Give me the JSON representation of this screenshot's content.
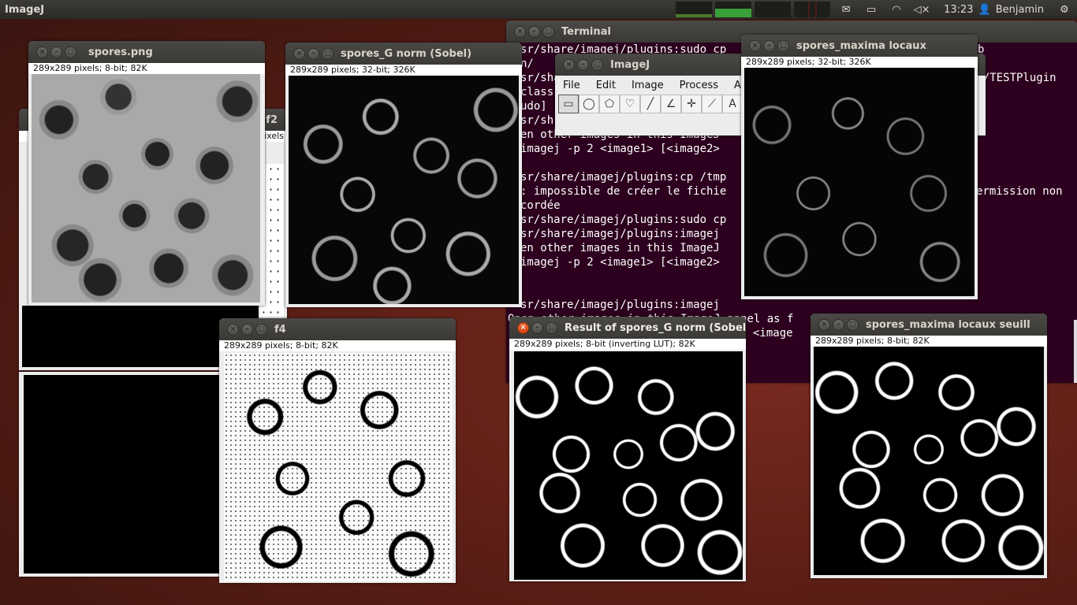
{
  "panel": {
    "app_title": "ImageJ",
    "time": "13:23",
    "user": "Benjamin",
    "icons": [
      "mail-icon",
      "battery-icon",
      "wifi-icon",
      "volume-icon",
      "gear-icon"
    ]
  },
  "windows": {
    "spores_png": {
      "title": "spores.png",
      "info": "289x289 pixels; 8-bit; 82K"
    },
    "hidden_f2": {
      "title": "f2",
      "info": "ixels"
    },
    "sobel": {
      "title": "spores_G norm (Sobel)",
      "info": "289x289 pixels; 32-bit; 326K"
    },
    "maxima": {
      "title": "spores_maxima locaux",
      "info": "289x289 pixels; 32-bit; 326K"
    },
    "f4": {
      "title": "f4",
      "info": "289x289 pixels; 8-bit; 82K"
    },
    "result": {
      "title": "Result of spores_G norm (Sobel)",
      "info": "289x289 pixels; 8-bit (inverting LUT); 82K"
    },
    "maxima_seuil": {
      "title": "spores_maxima locaux seuill",
      "info": "289x289 pixels; 8-bit; 82K"
    },
    "terminal": {
      "title": "Terminal",
      "lines": [
        "sr/share/imagej/plugins:sudo cp",
        "n/",
        "sr/share",
        "class",
        "udo]",
        "sr/sh",
        "en other images in this ImageJ",
        "imagej -p 2 <image1> [<image2>",
        "",
        "sr/share/imagej/plugins:cp /tmp",
        ": impossible de créer le fichie",
        "cordée",
        "sr/share/imagej/plugins:sudo cp",
        "sr/share/imagej/plugins:imagej",
        "en other images in this ImageJ",
        "imagej -p 2 <image1> [<image2>",
        "",
        "",
        "sr/share/imagej/plugins:imagej",
        "Open other images in this ImageJ panel as f",
        "imagej -p 2 <image1> [<image2> ... <image"
      ],
      "right_fragments": [
        "b",
        "in/TESTPlugin",
        "ermission non"
      ]
    },
    "imagej": {
      "title": "ImageJ",
      "menus": [
        "File",
        "Edit",
        "Image",
        "Process",
        "A"
      ],
      "tools": [
        "rectangle-tool-icon",
        "oval-tool-icon",
        "polygon-tool-icon",
        "freehand-tool-icon",
        "line-tool-icon",
        "angle-tool-icon",
        "point-tool-icon",
        "wand-tool-icon",
        "text-tool-icon"
      ]
    }
  }
}
